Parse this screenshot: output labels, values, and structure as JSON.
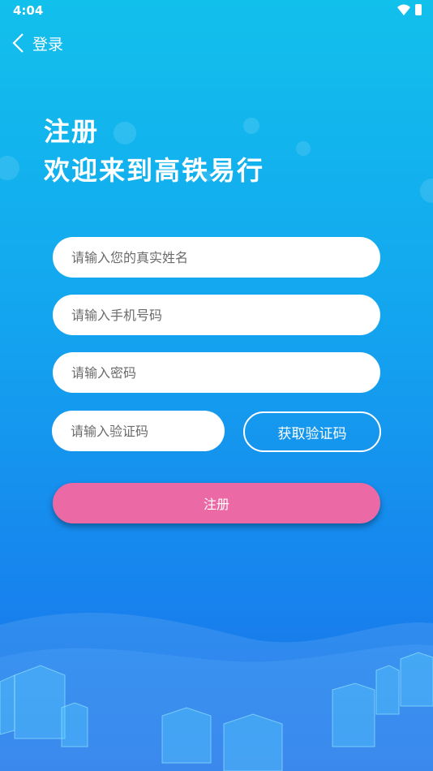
{
  "status": {
    "time": "4:04"
  },
  "nav": {
    "back_label": "登录"
  },
  "heading": {
    "line1": "注册",
    "line2": "欢迎来到高铁易行"
  },
  "form": {
    "name_placeholder": "请输入您的真实姓名",
    "phone_placeholder": "请输入手机号码",
    "password_placeholder": "请输入密码",
    "code_placeholder": "请输入验证码",
    "get_code_label": "获取验证码",
    "submit_label": "注册"
  },
  "colors": {
    "background_top": "#12c0ec",
    "background_bottom": "#1a6fe8",
    "submit_button": "#eb6aa5"
  },
  "icons": [
    "wifi-icon",
    "battery-icon",
    "back-chevron-icon"
  ]
}
